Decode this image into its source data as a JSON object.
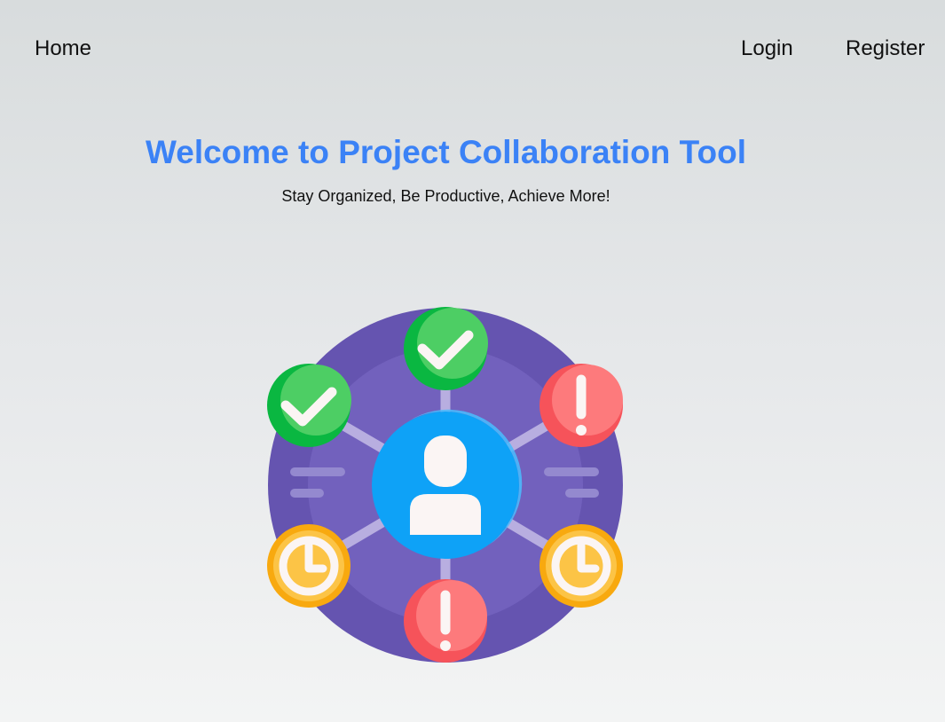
{
  "nav": {
    "home_label": "Home",
    "login_label": "Login",
    "register_label": "Register"
  },
  "hero": {
    "title": "Welcome to Project Collaboration Tool",
    "subtitle": "Stay Organized, Be Productive, Achieve More!"
  },
  "illustration": {
    "name": "team-collaboration-hub",
    "center_icon": "user-icon",
    "nodes": [
      "check-icon",
      "check-icon",
      "alert-icon",
      "alert-icon",
      "clock-icon",
      "clock-icon"
    ]
  },
  "colors": {
    "title": "#3b82f6",
    "hub_outer": "#6554b0",
    "hub_inner": "#7261bd",
    "user_circle": "#1aa3f5",
    "check_green": "#11c04a",
    "alert_red": "#fa5a5e",
    "clock_yellow": "#fbb418"
  }
}
